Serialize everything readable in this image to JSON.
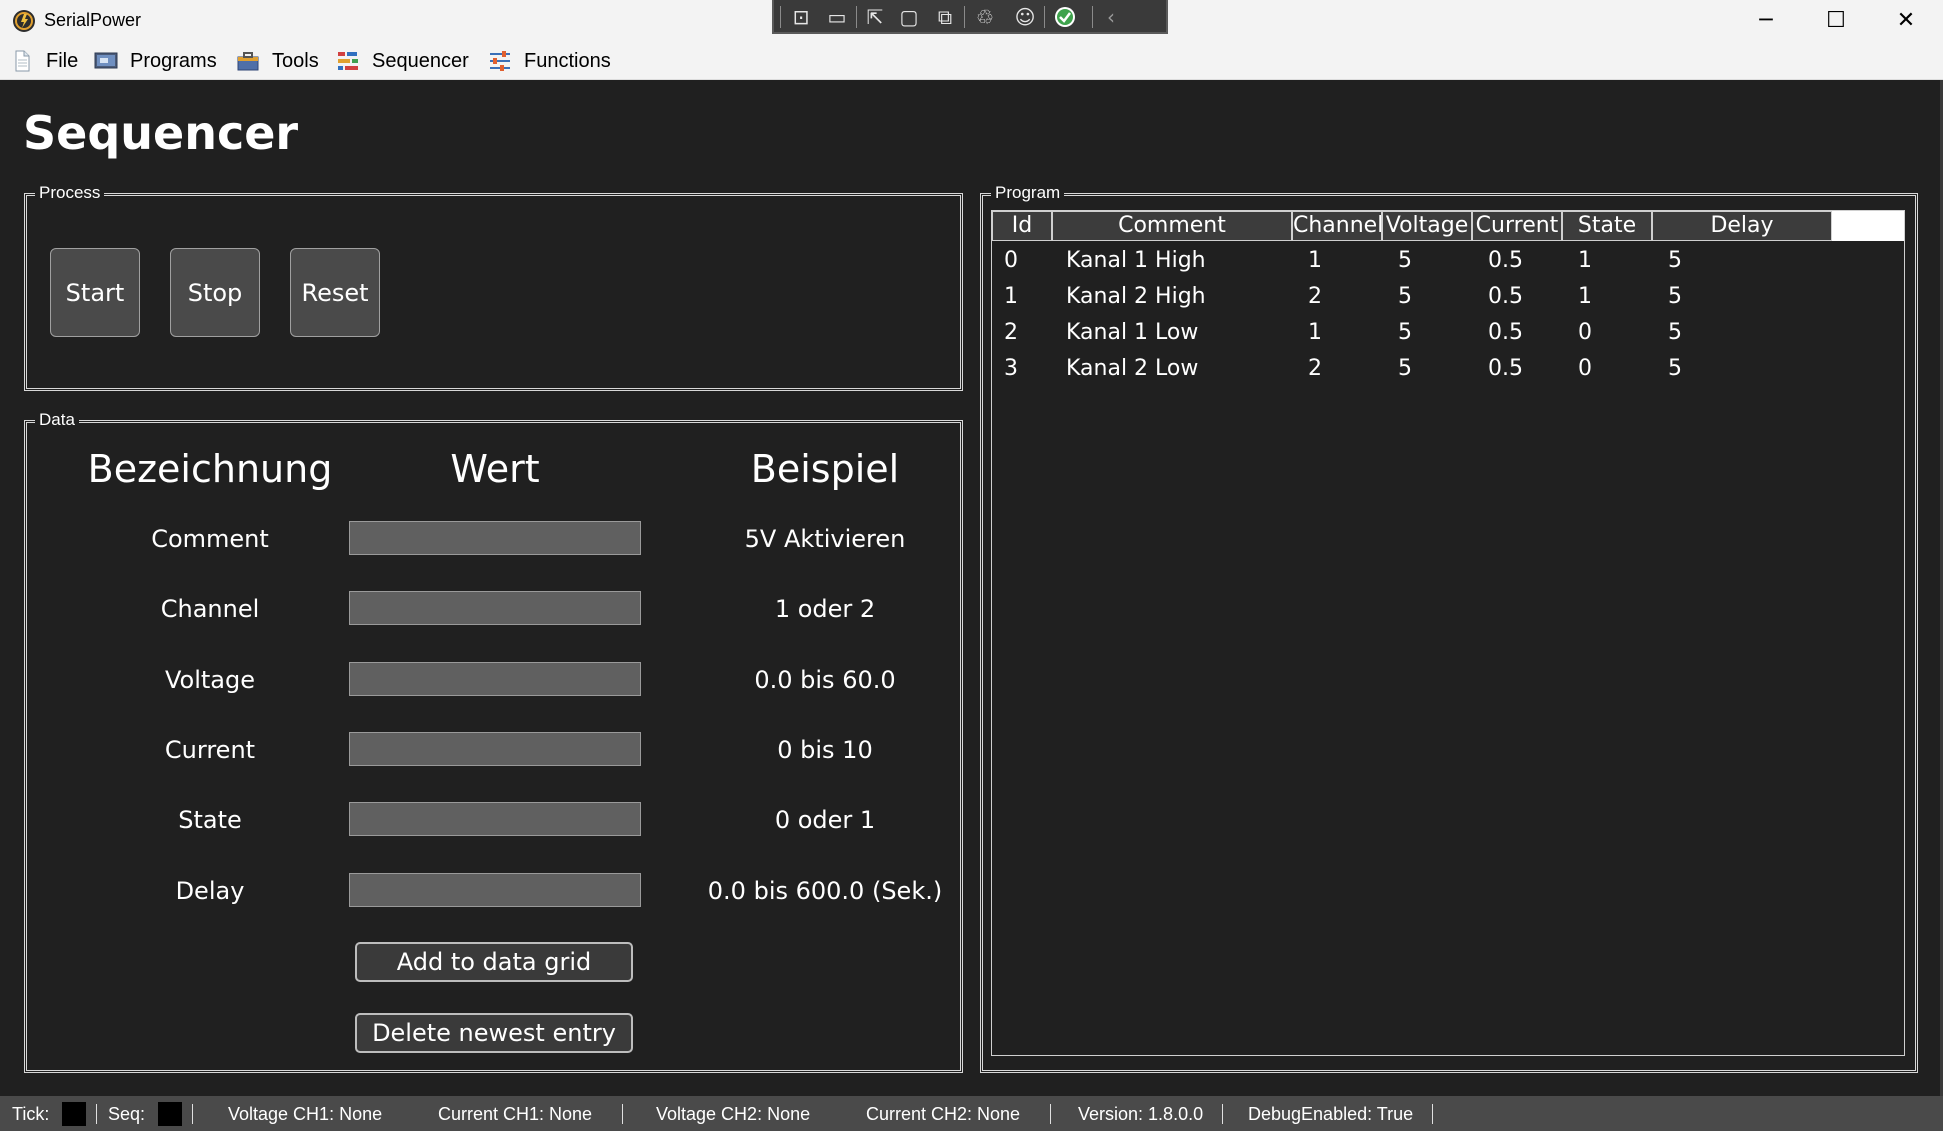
{
  "window": {
    "title": "SerialPower",
    "minimize_glyph": "─",
    "maximize_glyph": "☐",
    "close_glyph": "✕"
  },
  "debug_toolbar": {
    "icons": [
      "select-element-icon",
      "record-icon",
      "pointer-select-icon",
      "layout-adorners-icon",
      "track-focus-icon",
      "hot-reload-icon",
      "accessibility-icon",
      "binding-check-icon",
      "collapse-icon"
    ]
  },
  "menu": {
    "items": [
      {
        "label": "File",
        "icon": "document-icon"
      },
      {
        "label": "Programs",
        "icon": "programs-icon"
      },
      {
        "label": "Tools",
        "icon": "toolbox-icon"
      },
      {
        "label": "Sequencer",
        "icon": "sequencer-icon"
      },
      {
        "label": "Functions",
        "icon": "sliders-icon"
      }
    ]
  },
  "page": {
    "title": "Sequencer"
  },
  "process": {
    "title": "Process",
    "buttons": {
      "start": "Start",
      "stop": "Stop",
      "reset": "Reset"
    }
  },
  "data": {
    "title": "Data",
    "headers": {
      "name": "Bezeichnung",
      "value": "Wert",
      "example": "Beispiel"
    },
    "rows": [
      {
        "label": "Comment",
        "value": "",
        "example": "5V Aktivieren"
      },
      {
        "label": "Channel",
        "value": "",
        "example": "1 oder 2"
      },
      {
        "label": "Voltage",
        "value": "",
        "example": "0.0 bis 60.0"
      },
      {
        "label": "Current",
        "value": "",
        "example": "0 bis 10"
      },
      {
        "label": "State",
        "value": "",
        "example": "0 oder 1"
      },
      {
        "label": "Delay",
        "value": "",
        "example": "0.0 bis 600.0 (Sek.)"
      }
    ],
    "add_button": "Add to data grid",
    "delete_button": "Delete newest entry"
  },
  "program": {
    "title": "Program",
    "columns": [
      "Id",
      "Comment",
      "Channel",
      "Voltage",
      "Current",
      "State",
      "Delay"
    ],
    "rows": [
      [
        "0",
        "Kanal 1 High",
        "1",
        "5",
        "0.5",
        "1",
        "5"
      ],
      [
        "1",
        "Kanal 2 High",
        "2",
        "5",
        "0.5",
        "1",
        "5"
      ],
      [
        "2",
        "Kanal 1 Low",
        "1",
        "5",
        "0.5",
        "0",
        "5"
      ],
      [
        "3",
        "Kanal 2 Low",
        "2",
        "5",
        "0.5",
        "0",
        "5"
      ]
    ]
  },
  "status": {
    "tick_label": "Tick:",
    "seq_label": "Seq:",
    "voltage_ch1": "Voltage CH1: None",
    "current_ch1": "Current CH1: None",
    "voltage_ch2": "Voltage CH2: None",
    "current_ch2": "Current CH2: None",
    "version": "Version: 1.8.0.0",
    "debug": "DebugEnabled: True"
  },
  "colors": {
    "background": "#202020",
    "titlebar": "#f3f3f3",
    "statusbar": "#4a4a4a",
    "input": "#606060",
    "button": "#4a4a4a"
  }
}
